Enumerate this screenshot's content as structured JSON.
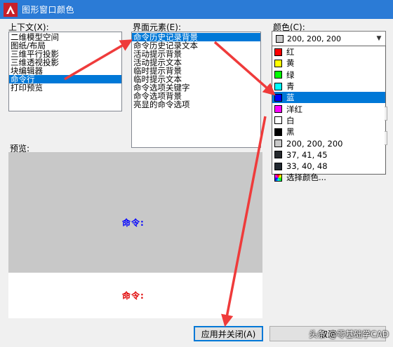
{
  "window": {
    "title": "图形窗口颜色"
  },
  "context": {
    "label": "上下文(X):",
    "items": [
      "二维模型空间",
      "图纸/布局",
      "三维平行投影",
      "三维透视投影",
      "块编辑器",
      "命令行",
      "打印预览"
    ],
    "selected_index": 5
  },
  "elements": {
    "label": "界面元素(E):",
    "items": [
      "命令历史记录背景",
      "命令历史记录文本",
      "活动提示背景",
      "活动提示文本",
      "临时提示背景",
      "临时提示文本",
      "命令选项关键字",
      "命令选项背景",
      "亮显的命令选项"
    ],
    "selected_index": 0
  },
  "color": {
    "label": "颜色(C):",
    "current_value": "200, 200, 200",
    "current_swatch": "#c8c8c8",
    "options": [
      {
        "label": "红",
        "swatch": "#ff0000"
      },
      {
        "label": "黄",
        "swatch": "#ffff00"
      },
      {
        "label": "绿",
        "swatch": "#00ff00"
      },
      {
        "label": "青",
        "swatch": "#00ffff"
      },
      {
        "label": "蓝",
        "swatch": "#0000ff"
      },
      {
        "label": "洋红",
        "swatch": "#ff00ff"
      },
      {
        "label": "白",
        "swatch": "#ffffff"
      },
      {
        "label": "黑",
        "swatch": "#000000"
      },
      {
        "label": "200, 200, 200",
        "swatch": "#c8c8c8"
      },
      {
        "label": "37, 41, 45",
        "swatch": "#25292d"
      },
      {
        "label": "33, 40, 48",
        "swatch": "#212830"
      },
      {
        "label": "选择颜色...",
        "swatch": "multicolor"
      }
    ],
    "highlighted_index": 4
  },
  "preview": {
    "label": "预览:",
    "top_text": "命令:",
    "top_text_color": "#0000ff",
    "top_bg": "#c8c8c8",
    "bottom_text": "命令:",
    "bottom_text_color": "#e00000"
  },
  "buttons": {
    "apply_close": "应用并关闭(A)",
    "cancel": "取消"
  },
  "watermark": "头条 @零基础学CAD",
  "annotation_color": "#ef3b3b"
}
